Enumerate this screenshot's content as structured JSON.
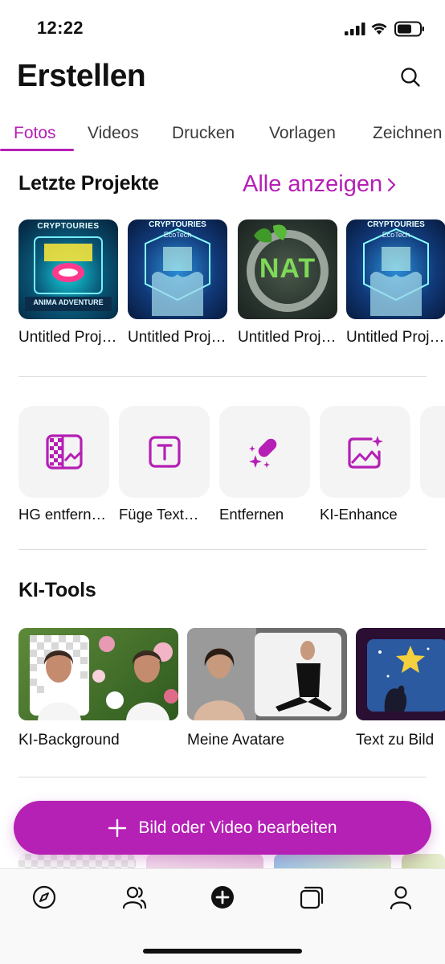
{
  "status": {
    "time": "12:22"
  },
  "header": {
    "title": "Erstellen"
  },
  "tabs": [
    {
      "label": "Fotos",
      "active": true
    },
    {
      "label": "Videos",
      "active": false
    },
    {
      "label": "Drucken",
      "active": false
    },
    {
      "label": "Vorlagen",
      "active": false
    },
    {
      "label": "Zeichnen",
      "active": false
    }
  ],
  "recent": {
    "title": "Letzte Projekte",
    "see_all": "Alle anzeigen",
    "items": [
      {
        "label": "Untitled Proj…",
        "thumb_text": "CRYPTOURIES",
        "sub_text": "ANIMA ADVENTURE"
      },
      {
        "label": "Untitled Proj…",
        "thumb_text": "CRYPTOURIES",
        "sub_text": "EcoTech"
      },
      {
        "label": "Untitled Proj…",
        "thumb_text": "NAT",
        "sub_text": ""
      },
      {
        "label": "Untitled Proj…",
        "thumb_text": "CRYPTOURIES",
        "sub_text": "EcoTech"
      }
    ]
  },
  "quick_tools": [
    {
      "label": "HG entfern…",
      "icon": "background-remove-icon"
    },
    {
      "label": "Füge Text…",
      "icon": "text-icon"
    },
    {
      "label": "Entfernen",
      "icon": "eraser-magic-icon"
    },
    {
      "label": "KI-Enhance",
      "icon": "image-sparkle-icon"
    }
  ],
  "ai_tools": {
    "title": "KI-Tools",
    "items": [
      {
        "label": "KI-Background"
      },
      {
        "label": "Meine Avatare"
      },
      {
        "label": "Text zu Bild"
      }
    ]
  },
  "main_action": {
    "label": "Bild oder Video bearbeiten"
  },
  "tabbar": [
    {
      "icon": "compass-icon"
    },
    {
      "icon": "community-icon"
    },
    {
      "icon": "create-plus-icon"
    },
    {
      "icon": "projects-icon"
    },
    {
      "icon": "profile-icon"
    }
  ],
  "colors": {
    "accent": "#b51fb5",
    "text": "#111111"
  }
}
